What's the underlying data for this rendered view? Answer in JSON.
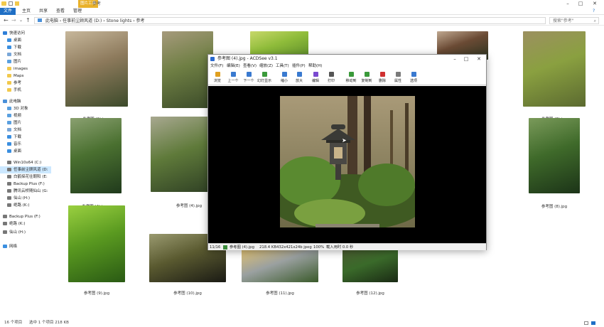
{
  "explorer": {
    "window_title": "参考",
    "picture_tools_label": "图片工具",
    "tabs": [
      "文件",
      "主页",
      "共享",
      "查看",
      "管理"
    ],
    "address": {
      "segments": [
        "此电脑",
        "任事前尘顾风道 (D:)",
        "Stone lights",
        "参考"
      ],
      "search_placeholder": "搜索\"参考\""
    },
    "sidebar": [
      {
        "label": "快速访问",
        "icon": "star-icon",
        "color": "#2f7fd8"
      },
      {
        "label": "桌面",
        "icon": "desktop-icon",
        "color": "#3b8fe0"
      },
      {
        "label": "下载",
        "icon": "download-icon",
        "color": "#3b8fe0"
      },
      {
        "label": "文档",
        "icon": "document-icon",
        "color": "#7aa7d8"
      },
      {
        "label": "图片",
        "icon": "picture-icon",
        "color": "#5aa0e0"
      },
      {
        "label": "images",
        "icon": "folder-icon",
        "color": "#f2c94c"
      },
      {
        "label": "Maps",
        "icon": "folder-icon",
        "color": "#f2c94c"
      },
      {
        "label": "参考",
        "icon": "folder-icon",
        "color": "#f2c94c"
      },
      {
        "label": "手机",
        "icon": "folder-icon",
        "color": "#f2c94c"
      },
      {
        "label": "此电脑",
        "icon": "computer-icon",
        "color": "#4a90d9"
      },
      {
        "label": "3D 对象",
        "icon": "cube-icon",
        "color": "#5aa0e0"
      },
      {
        "label": "视频",
        "icon": "video-icon",
        "color": "#5aa0e0"
      },
      {
        "label": "图片",
        "icon": "picture-icon",
        "color": "#5aa0e0"
      },
      {
        "label": "文档",
        "icon": "document-icon",
        "color": "#7aa7d8"
      },
      {
        "label": "下载",
        "icon": "download-icon",
        "color": "#3b8fe0"
      },
      {
        "label": "音乐",
        "icon": "music-icon",
        "color": "#3b8fe0"
      },
      {
        "label": "桌面",
        "icon": "desktop-icon",
        "color": "#3b8fe0"
      },
      {
        "label": "Win10x64 (C:)",
        "icon": "drive-icon",
        "color": "#777777"
      },
      {
        "label": "任事前尘顾风道 (D:",
        "icon": "drive-icon",
        "color": "#777777"
      },
      {
        "label": "白鹤探花往朝阳 (E:",
        "icon": "drive-icon",
        "color": "#777777"
      },
      {
        "label": "Backup Plus (F:)",
        "icon": "drive-icon",
        "color": "#777777"
      },
      {
        "label": "腾讯云桥随仙山 (G:",
        "icon": "drive-icon",
        "color": "#777777"
      },
      {
        "label": "仙山 (H:)",
        "icon": "drive-icon",
        "color": "#777777"
      },
      {
        "label": "绝路 (K:)",
        "icon": "drive-icon",
        "color": "#777777"
      },
      {
        "label": "Backup Plus (F:)",
        "icon": "drive-icon",
        "color": "#777777"
      },
      {
        "label": "绝路 (K:)",
        "icon": "drive-icon",
        "color": "#777777"
      },
      {
        "label": "仙山 (H:)",
        "icon": "drive-icon",
        "color": "#777777"
      },
      {
        "label": "网络",
        "icon": "network-icon",
        "color": "#3b8fe0"
      }
    ],
    "files": [
      {
        "name": "参考图 (1).jpeg",
        "colors": [
          "#3c4a2a",
          "#8d7a5c",
          "#c7b79b"
        ]
      },
      {
        "name": "参考图 (1).jpg",
        "colors": [
          "#3a4a28",
          "#6f7f44",
          "#a69a7c"
        ]
      },
      {
        "name": "",
        "colors": [
          "#5a8a2a",
          "#8fbc3a",
          "#c8d86a"
        ]
      },
      {
        "name": "",
        "colors": [
          "#2a3420",
          "#6a4a34",
          "#c0a890"
        ]
      },
      {
        "name": "参考图 (3).jpg",
        "colors": [
          "#5b6a30",
          "#8aa040",
          "#9c9060"
        ]
      },
      {
        "name": "参考图 (4).jpeg",
        "colors": [
          "#203a1c",
          "#4a7030",
          "#8aa070"
        ]
      },
      {
        "name": "参考图 (4).jpg",
        "colors": [
          "#2a3a22",
          "#5f7a3a",
          "#a8a890"
        ]
      },
      {
        "name": "参考图 (8).jpg",
        "colors": [
          "#1c3418",
          "#3f6a2a",
          "#7a9a5a"
        ]
      },
      {
        "name": "参考图 (9).jpg",
        "colors": [
          "#2a5a14",
          "#5a9a20",
          "#9ad040"
        ]
      },
      {
        "name": "参考图 (10).jpg",
        "colors": [
          "#1a1a14",
          "#5a5a30",
          "#9a9a70"
        ]
      },
      {
        "name": "参考图 (11).jpg",
        "colors": [
          "#3a5a2a",
          "#9aa0a0",
          "#e0c070"
        ]
      },
      {
        "name": "参考图 (12).jpg",
        "colors": [
          "#1a2a14",
          "#3a6a2a",
          "#4a5a30"
        ]
      }
    ],
    "status": {
      "count": "16 个项目",
      "selection": "选中 1 个项目  218 KB"
    }
  },
  "acdsee": {
    "title": "参考图 (4).jpg - ACDSee v3.1",
    "menu": [
      "文件(F)",
      "编辑(E)",
      "查看(V)",
      "缩放(Z)",
      "工具(T)",
      "插件(P)",
      "帮助(H)"
    ],
    "toolbar": [
      {
        "label": "浏览",
        "icon": "browse-icon",
        "color": "#e0a020"
      },
      {
        "label": "上一个",
        "icon": "previous-icon",
        "color": "#3a7ad0"
      },
      {
        "label": "下一个",
        "icon": "next-icon",
        "color": "#3a7ad0"
      },
      {
        "label": "幻灯显示",
        "icon": "slideshow-icon",
        "color": "#3a9a3a"
      },
      {
        "label": "缩小",
        "icon": "zoom-out-icon",
        "color": "#3a7ad0"
      },
      {
        "label": "放大",
        "icon": "zoom-in-icon",
        "color": "#3a7ad0"
      },
      {
        "label": "编辑",
        "icon": "edit-icon",
        "color": "#7a4ad0"
      },
      {
        "label": "打印",
        "icon": "print-icon",
        "color": "#555555"
      },
      {
        "label": "移动到",
        "icon": "move-icon",
        "color": "#3a9a3a"
      },
      {
        "label": "复制到",
        "icon": "copy-icon",
        "color": "#3a9a3a"
      },
      {
        "label": "删除",
        "icon": "delete-icon",
        "color": "#d03030"
      },
      {
        "label": "属性",
        "icon": "properties-icon",
        "color": "#7a7a7a"
      },
      {
        "label": "选项",
        "icon": "options-icon",
        "color": "#3a7ad0"
      }
    ],
    "status": {
      "index": "11/16",
      "filename": "参考图 (4).jpg",
      "size": "218.4 KB",
      "dims": "432x421x24b jpeg",
      "zoom": "100%",
      "load_time": "载入用时 0.0 秒"
    }
  }
}
